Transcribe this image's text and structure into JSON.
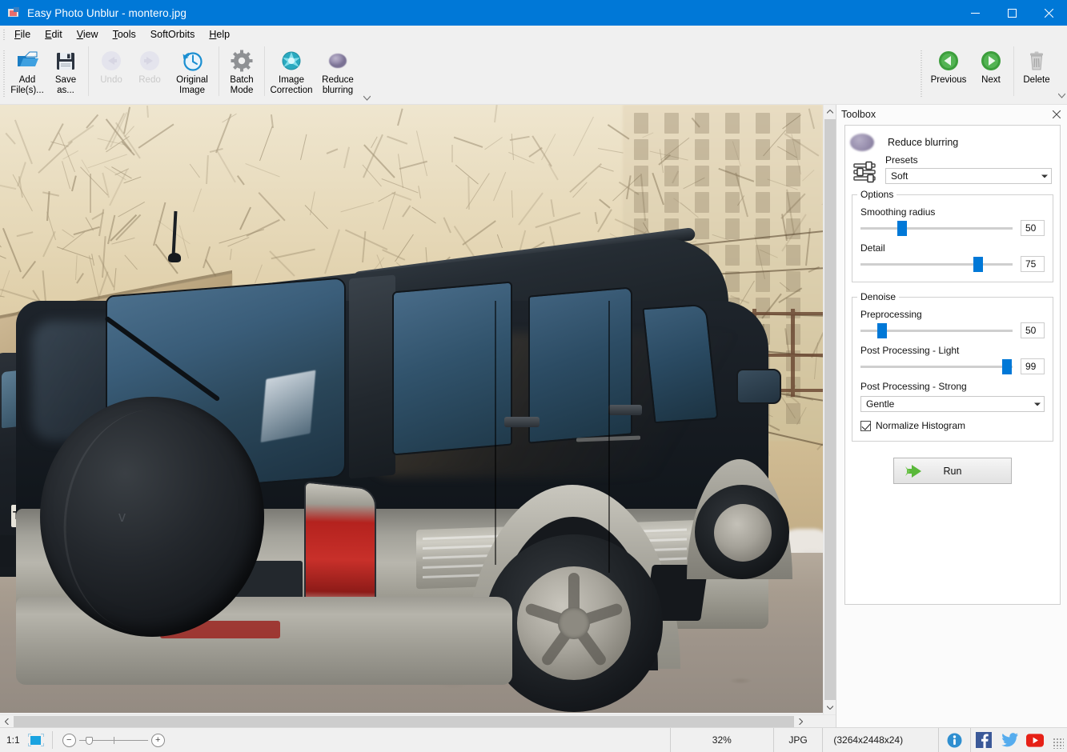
{
  "window": {
    "app_name": "Easy Photo Unblur",
    "file_name": "montero.jpg",
    "title": "Easy Photo Unblur - montero.jpg",
    "app_icon": "photo-app-icon",
    "minimize": "minimize-icon",
    "maximize": "maximize-icon",
    "close": "close-icon",
    "accent_color": "#0078d7"
  },
  "menubar": {
    "items": [
      {
        "label": "File",
        "mnemonic": "F"
      },
      {
        "label": "Edit",
        "mnemonic": "E"
      },
      {
        "label": "View",
        "mnemonic": "V"
      },
      {
        "label": "Tools",
        "mnemonic": "T"
      },
      {
        "label": "SoftOrbits",
        "mnemonic": ""
      },
      {
        "label": "Help",
        "mnemonic": "H"
      }
    ]
  },
  "toolbar": {
    "buttons": [
      {
        "label_line1": "Add",
        "label_line2": "File(s)...",
        "icon": "open-folder-icon",
        "enabled": true
      },
      {
        "label_line1": "Save",
        "label_line2": "as...",
        "icon": "floppy-disk-icon",
        "enabled": true
      },
      {
        "label_line1": "Undo",
        "label_line2": "",
        "icon": "undo-arrow-icon",
        "enabled": false
      },
      {
        "label_line1": "Redo",
        "label_line2": "",
        "icon": "redo-arrow-icon",
        "enabled": false
      },
      {
        "label_line1": "Original",
        "label_line2": "Image",
        "icon": "clock-history-icon",
        "enabled": true
      },
      {
        "label_line1": "Batch",
        "label_line2": "Mode",
        "icon": "gear-icon",
        "enabled": true
      },
      {
        "label_line1": "Image",
        "label_line2": "Correction",
        "icon": "teal-star-burst-icon",
        "enabled": true
      },
      {
        "label_line1": "Reduce",
        "label_line2": "blurring",
        "icon": "purple-blur-orb-icon",
        "enabled": true
      }
    ],
    "right_buttons": [
      {
        "label_line1": "Previous",
        "label_line2": "",
        "icon": "green-left-arrow-icon",
        "enabled": true
      },
      {
        "label_line1": "Next",
        "label_line2": "",
        "icon": "green-right-arrow-icon",
        "enabled": true
      },
      {
        "label_line1": "Delete",
        "label_line2": "",
        "icon": "trash-can-icon",
        "enabled": true
      }
    ],
    "overflow_icon": "chevron-down-icon"
  },
  "toolbox": {
    "title": "Toolbox",
    "close_icon": "close-icon",
    "tool_name": "Reduce blurring",
    "tool_icon": "purple-blur-orb-icon",
    "sliders_icon": "sliders-icon",
    "presets": {
      "label": "Presets",
      "value": "Soft",
      "dropdown_icon": "chevron-down-icon"
    },
    "options": {
      "title": "Options",
      "controls": [
        {
          "label": "Smoothing radius",
          "value": "50",
          "percent": 24
        },
        {
          "label": "Detail",
          "value": "75",
          "percent": 74
        }
      ]
    },
    "denoise": {
      "title": "Denoise",
      "controls": [
        {
          "label": "Preprocessing",
          "value": "50",
          "percent": 11
        },
        {
          "label": "Post Processing - Light",
          "value": "99",
          "percent": 95
        }
      ],
      "strong": {
        "label": "Post Processing - Strong",
        "value": "Gentle",
        "dropdown_icon": "chevron-down-icon"
      },
      "normalize": {
        "label": "Normalize Histogram",
        "checked": true
      }
    },
    "run": {
      "label": "Run",
      "icon": "green-play-arrow-icon"
    }
  },
  "canvas": {
    "photo_alt": "Dark green Mitsubishi Pajero Montero SUV parked on gravel, rear three-quarter view",
    "vscroll_up_icon": "chevron-up-icon",
    "vscroll_down_icon": "chevron-down-icon",
    "hscroll_left_icon": "chevron-left-icon",
    "hscroll_right_icon": "chevron-right-icon"
  },
  "statusbar": {
    "ratio": "1:1",
    "fit_icon": "fit-to-window-icon",
    "zoom_out_icon": "minus-icon",
    "zoom_in_icon": "plus-icon",
    "zoom_percent": "32%",
    "format": "JPG",
    "dimensions": "(3264x2448x24)",
    "info_icon": "info-icon",
    "facebook_icon": "facebook-icon",
    "twitter_icon": "twitter-icon",
    "youtube_icon": "youtube-icon",
    "resize_grip": "resize-grip-icon"
  }
}
